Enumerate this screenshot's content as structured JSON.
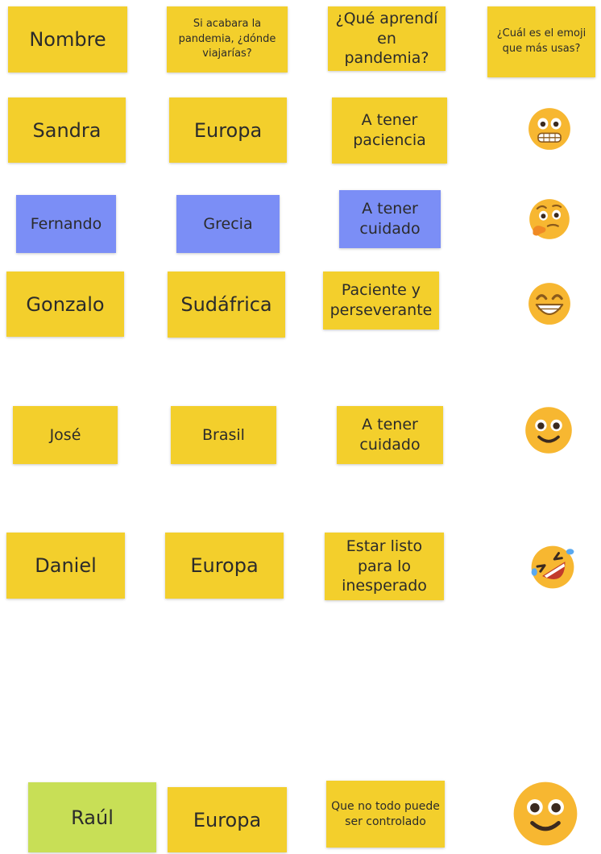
{
  "headers": {
    "name": "Nombre",
    "travel": "Si acabara la pandemia, ¿dónde viajarías?",
    "learned": "¿Qué aprendí en pandemia?",
    "emoji": "¿Cuál es el emoji que más usas?"
  },
  "rows": [
    {
      "name": "Sandra",
      "travel": "Europa",
      "learned": "A tener paciencia",
      "emoji": "grimacing-face-icon"
    },
    {
      "name": "Fernando",
      "travel": "Grecia",
      "learned": "A tener cuidado",
      "emoji": "thinking-face-icon"
    },
    {
      "name": "Gonzalo",
      "travel": "Sudáfrica",
      "learned": "Paciente y perseverante",
      "emoji": "grinning-face-icon"
    },
    {
      "name": "José",
      "travel": "Brasil",
      "learned": "A tener cuidado",
      "emoji": "smiling-face-icon"
    },
    {
      "name": "Daniel",
      "travel": "Europa",
      "learned": "Estar listo para lo inesperado",
      "emoji": "rolling-on-floor-laughing-icon"
    },
    {
      "name": "Raúl",
      "travel": "Europa",
      "learned": "Que no todo puede ser controlado",
      "emoji": "smiling-face-icon"
    }
  ],
  "colors": {
    "yellow_note": "#f3cf2c",
    "blue_note": "#7b8ef6",
    "green_note": "#c8df56",
    "emoji_face": "#f7b731"
  }
}
